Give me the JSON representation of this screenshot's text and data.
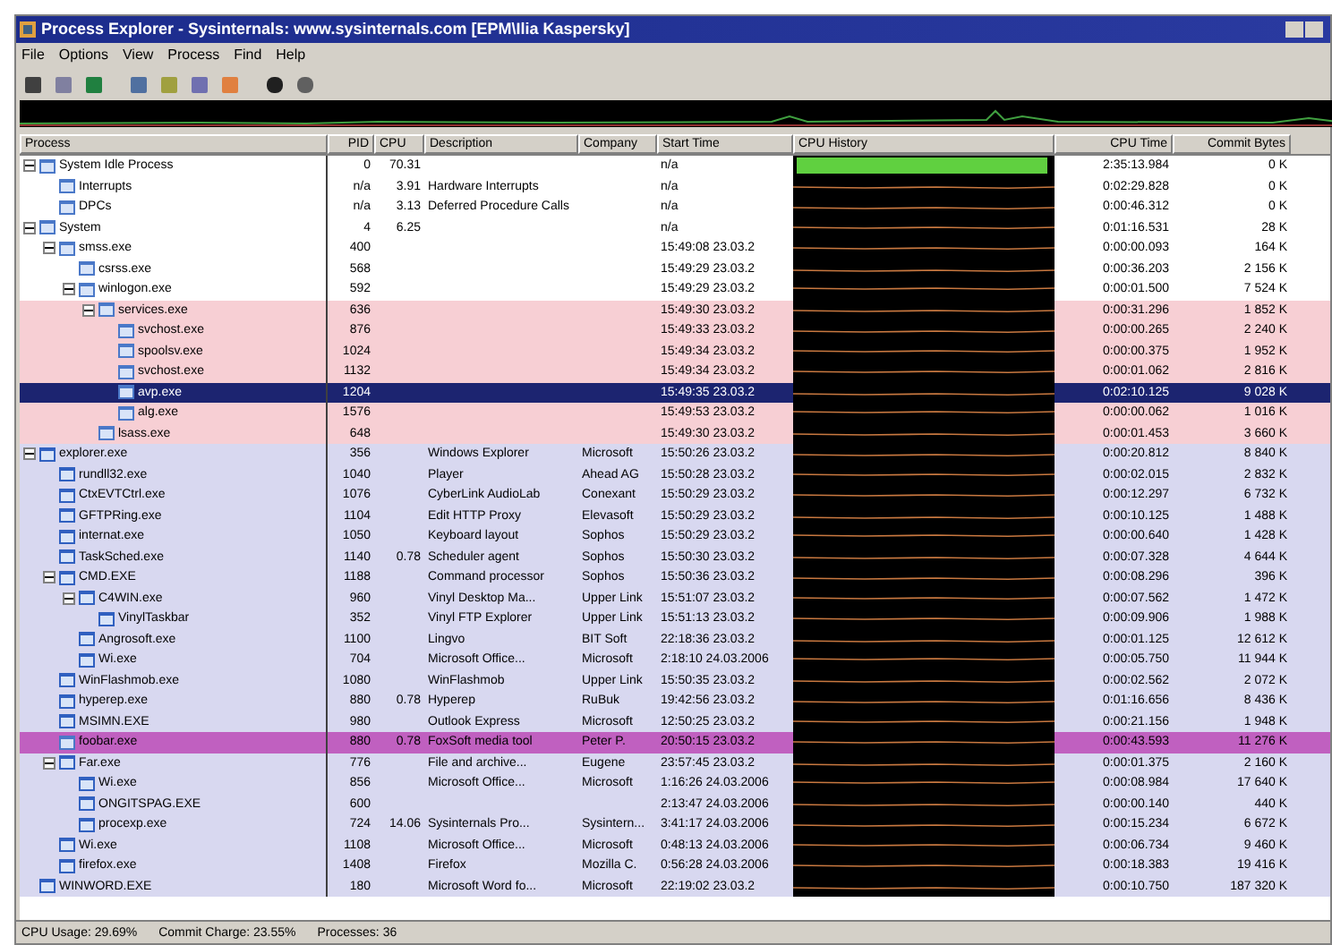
{
  "window": {
    "title": "Process Explorer - Sysinternals: www.sysinternals.com [EPM\\Ilia Kaspersky]"
  },
  "menu": [
    "File",
    "Options",
    "View",
    "Process",
    "Find",
    "Help"
  ],
  "columns": [
    "Process",
    "PID",
    "CPU",
    "Description",
    "Company",
    "Start Time",
    "CPU History",
    "CPU Time",
    "Commit Bytes"
  ],
  "processes": [
    {
      "name": "System Idle Process",
      "pid": "0",
      "cpu": "70.31",
      "start": "n/a",
      "cpu_time": "2:35:13.984",
      "commit": "0 K",
      "kind": "idle",
      "selected": false,
      "expanded": true,
      "children": [
        {
          "name": "Interrupts",
          "pid": "n/a",
          "cpu": "3.91",
          "description": "Hardware Interrupts",
          "start": "n/a",
          "cpu_time": "0:02:29.828",
          "commit": "0 K",
          "kind": "idle",
          "selected": false
        },
        {
          "name": "DPCs",
          "pid": "n/a",
          "cpu": "3.13",
          "description": "Deferred Procedure Calls",
          "start": "n/a",
          "cpu_time": "0:00:46.312",
          "commit": "0 K",
          "kind": "idle",
          "selected": false
        }
      ]
    },
    {
      "name": "System",
      "pid": "4",
      "cpu": "6.25",
      "start": "n/a",
      "cpu_time": "0:01:16.531",
      "commit": "28 K",
      "kind": "system",
      "selected": false,
      "expanded": true,
      "children": [
        {
          "name": "smss.exe",
          "pid": "400",
          "start": "15:49:08 23.03.2",
          "cpu_time": "0:00:00.093",
          "commit": "164 K",
          "kind": "system",
          "selected": false,
          "expanded": true,
          "children": [
            {
              "name": "csrss.exe",
              "pid": "568",
              "start": "15:49:29 23.03.2",
              "cpu_time": "0:00:36.203",
              "commit": "2 156 K",
              "kind": "system",
              "selected": false
            },
            {
              "name": "winlogon.exe",
              "pid": "592",
              "start": "15:49:29 23.03.2",
              "cpu_time": "0:00:01.500",
              "commit": "7 524 K",
              "kind": "system",
              "selected": false,
              "expanded": true,
              "children": [
                {
                  "name": "services.exe",
                  "pid": "636",
                  "start": "15:49:30 23.03.2",
                  "cpu_time": "0:00:31.296",
                  "commit": "1 852 K",
                  "kind": "service",
                  "selected": false,
                  "expanded": true,
                  "children": [
                    {
                      "name": "svchost.exe",
                      "pid": "876",
                      "start": "15:49:33 23.03.2",
                      "cpu_time": "0:00:00.265",
                      "commit": "2 240 K",
                      "kind": "service",
                      "selected": false
                    },
                    {
                      "name": "spoolsv.exe",
                      "pid": "1024",
                      "start": "15:49:34 23.03.2",
                      "cpu_time": "0:00:00.375",
                      "commit": "1 952 K",
                      "kind": "service",
                      "selected": false
                    },
                    {
                      "name": "svchost.exe",
                      "pid": "1132",
                      "start": "15:49:34 23.03.2",
                      "cpu_time": "0:00:01.062",
                      "commit": "2 816 K",
                      "kind": "service",
                      "selected": false
                    },
                    {
                      "name": "avp.exe",
                      "pid": "1204",
                      "start": "15:49:35 23.03.2",
                      "cpu_time": "0:02:10.125",
                      "commit": "9 028 K",
                      "kind": "service",
                      "selected": true
                    },
                    {
                      "name": "alg.exe",
                      "pid": "1576",
                      "start": "15:49:53 23.03.2",
                      "cpu_time": "0:00:00.062",
                      "commit": "1 016 K",
                      "kind": "service",
                      "selected": false
                    }
                  ]
                },
                {
                  "name": "lsass.exe",
                  "pid": "648",
                  "start": "15:49:30 23.03.2",
                  "cpu_time": "0:00:01.453",
                  "commit": "3 660 K",
                  "kind": "service",
                  "selected": false
                }
              ]
            }
          ]
        }
      ]
    },
    {
      "name": "explorer.exe",
      "pid": "356",
      "description": "Windows Explorer",
      "company": "Microsoft",
      "start": "15:50:26 23.03.2",
      "cpu_time": "0:00:20.812",
      "commit": "8 840 K",
      "kind": "user",
      "selected": false,
      "expanded": true,
      "children": [
        {
          "name": "rundll32.exe",
          "pid": "1040",
          "description": "Player",
          "company": "Ahead AG",
          "start": "15:50:28 23.03.2",
          "cpu_time": "0:00:02.015",
          "commit": "2 832 K",
          "kind": "user",
          "selected": false
        },
        {
          "name": "CtxEVTCtrl.exe",
          "pid": "1076",
          "description": "CyberLink AudioLab",
          "company": "Conexant",
          "start": "15:50:29 23.03.2",
          "cpu_time": "0:00:12.297",
          "commit": "6 732 K",
          "kind": "user",
          "selected": false
        },
        {
          "name": "GFTPRing.exe",
          "pid": "1104",
          "description": "Edit HTTP Proxy",
          "company": "Elevasoft",
          "start": "15:50:29 23.03.2",
          "cpu_time": "0:00:10.125",
          "commit": "1 488 K",
          "kind": "user",
          "selected": false
        },
        {
          "name": "internat.exe",
          "pid": "1050",
          "description": "Keyboard layout",
          "company": "Sophos",
          "start": "15:50:29 23.03.2",
          "cpu_time": "0:00:00.640",
          "commit": "1 428 K",
          "kind": "user",
          "selected": false
        },
        {
          "name": "TaskSched.exe",
          "pid": "1140",
          "cpu": "0.78",
          "description": "Scheduler agent",
          "company": "Sophos",
          "start": "15:50:30 23.03.2",
          "cpu_time": "0:00:07.328",
          "commit": "4 644 K",
          "kind": "user",
          "selected": false
        },
        {
          "name": "CMD.EXE",
          "pid": "1188",
          "description": "Command processor",
          "company": "Sophos",
          "start": "15:50:36 23.03.2",
          "cpu_time": "0:00:08.296",
          "commit": "396 K",
          "kind": "user",
          "selected": false,
          "expanded": true,
          "children": [
            {
              "name": "C4WIN.exe",
              "pid": "960",
              "description": "Vinyl Desktop Ma...",
              "company": "Upper Link",
              "start": "15:51:07 23.03.2",
              "cpu_time": "0:00:07.562",
              "commit": "1 472 K",
              "kind": "user",
              "selected": false,
              "expanded": true,
              "children": [
                {
                  "name": "VinylTaskbar",
                  "pid": "352",
                  "description": "Vinyl FTP Explorer",
                  "company": "Upper Link",
                  "start": "15:51:13 23.03.2",
                  "cpu_time": "0:00:09.906",
                  "commit": "1 988 K",
                  "kind": "user",
                  "selected": false
                }
              ]
            },
            {
              "name": "Angrosoft.exe",
              "pid": "1100",
              "description": "Lingvo",
              "company": "BIT Soft",
              "start": "22:18:36 23.03.2",
              "cpu_time": "0:00:01.125",
              "commit": "12 612 K",
              "kind": "user",
              "selected": false
            },
            {
              "name": "Wi.exe",
              "pid": "704",
              "description": "Microsoft Office...",
              "company": "Microsoft",
              "start": "2:18:10 24.03.2006",
              "cpu_time": "0:00:05.750",
              "commit": "11 944 K",
              "kind": "user",
              "selected": false
            }
          ]
        },
        {
          "name": "WinFlashmob.exe",
          "pid": "1080",
          "description": "WinFlashmob",
          "company": "Upper Link",
          "start": "15:50:35 23.03.2",
          "cpu_time": "0:00:02.562",
          "commit": "2 072 K",
          "kind": "user",
          "selected": false
        },
        {
          "name": "hyperep.exe",
          "pid": "880",
          "cpu": "0.78",
          "description": "Hyperep",
          "company": "RuBuk",
          "start": "19:42:56 23.03.2",
          "cpu_time": "0:01:16.656",
          "commit": "8 436 K",
          "kind": "user",
          "selected": false
        },
        {
          "name": "MSIMN.EXE",
          "pid": "980",
          "description": "Outlook Express",
          "company": "Microsoft",
          "start": "12:50:25 23.03.2",
          "cpu_time": "0:00:21.156",
          "commit": "1 948 K",
          "kind": "user",
          "selected": false
        },
        {
          "name": "foobar.exe",
          "pid": "880",
          "cpu": "0.78",
          "description": "FoxSoft media tool",
          "company": "Peter P.",
          "start": "20:50:15 23.03.2",
          "cpu_time": "0:00:43.593",
          "commit": "11 276 K",
          "kind": "packed",
          "selected": false
        },
        {
          "name": "Far.exe",
          "pid": "776",
          "description": "File and archive...",
          "company": "Eugene",
          "start": "23:57:45 23.03.2",
          "cpu_time": "0:00:01.375",
          "commit": "2 160 K",
          "kind": "user",
          "selected": false,
          "expanded": true,
          "children": [
            {
              "name": "Wi.exe",
              "pid": "856",
              "description": "Microsoft Office...",
              "company": "Microsoft",
              "start": "1:16:26 24.03.2006",
              "cpu_time": "0:00:08.984",
              "commit": "17 640 K",
              "kind": "user",
              "selected": false
            },
            {
              "name": "ONGITSPAG.EXE",
              "pid": "600",
              "start": "2:13:47 24.03.2006",
              "cpu_time": "0:00:00.140",
              "commit": "440 K",
              "kind": "user",
              "selected": false
            },
            {
              "name": "procexp.exe",
              "pid": "724",
              "cpu": "14.06",
              "description": "Sysinternals Pro...",
              "company": "Sysintern...",
              "start": "3:41:17 24.03.2006",
              "cpu_time": "0:00:15.234",
              "commit": "6 672 K",
              "kind": "user",
              "selected": false
            }
          ]
        },
        {
          "name": "Wi.exe",
          "pid": "1108",
          "description": "Microsoft Office...",
          "company": "Microsoft",
          "start": "0:48:13 24.03.2006",
          "cpu_time": "0:00:06.734",
          "commit": "9 460 K",
          "kind": "user",
          "selected": false
        },
        {
          "name": "firefox.exe",
          "pid": "1408",
          "description": "Firefox",
          "company": "Mozilla C.",
          "start": "0:56:28 24.03.2006",
          "cpu_time": "0:00:18.383",
          "commit": "19 416 K",
          "kind": "user",
          "selected": false
        }
      ]
    },
    {
      "name": "WINWORD.EXE",
      "pid": "180",
      "description": "Microsoft Word fo...",
      "company": "Microsoft",
      "start": "22:19:02 23.03.2",
      "cpu_time": "0:00:10.750",
      "commit": "187 320 K",
      "kind": "user",
      "selected": false
    }
  ],
  "status": [
    "CPU Usage: 29.69%",
    "Commit Charge: 23.55%",
    "Processes: 36"
  ]
}
